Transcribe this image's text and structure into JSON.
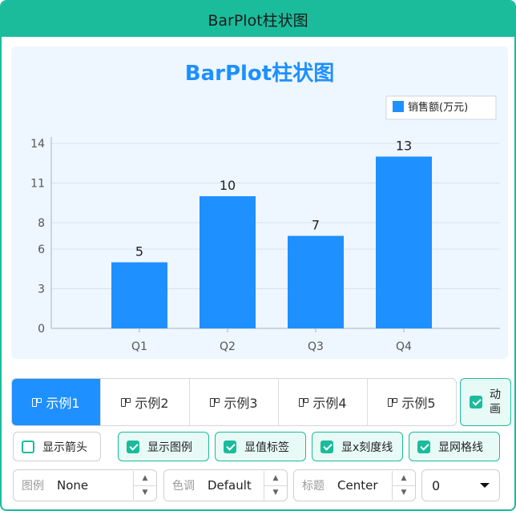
{
  "window": {
    "title": "BarPlot柱状图"
  },
  "chart_data": {
    "type": "bar",
    "title": "BarPlot柱状图",
    "categories": [
      "Q1",
      "Q2",
      "Q3",
      "Q4"
    ],
    "series": [
      {
        "name": "销售额(万元)",
        "values": [
          5,
          10,
          7,
          13
        ],
        "color": "#1e90ff"
      }
    ],
    "data_labels": [
      "5",
      "10",
      "7",
      "13"
    ],
    "ylim": [
      0,
      14
    ],
    "y_ticks": [
      0,
      3,
      6,
      8,
      11,
      14
    ],
    "grid": true,
    "legend_position": "top-right"
  },
  "colors": {
    "accent": "#1abc9c",
    "bar": "#1e90ff",
    "chart_bg": "#eef6ff",
    "title": "#1e90ff"
  },
  "tabs": [
    {
      "label": "示例1",
      "active": true
    },
    {
      "label": "示例2",
      "active": false
    },
    {
      "label": "示例3",
      "active": false
    },
    {
      "label": "示例4",
      "active": false
    },
    {
      "label": "示例5",
      "active": false
    }
  ],
  "animation": {
    "label": "动画",
    "checked": true
  },
  "options": [
    {
      "label": "显示箭头",
      "checked": false
    },
    {
      "label": "显示图例",
      "checked": true
    },
    {
      "label": "显值标签",
      "checked": true
    },
    {
      "label": "显x刻度线",
      "checked": true
    },
    {
      "label": "显网格线",
      "checked": true
    }
  ],
  "spinners": [
    {
      "label": "图例",
      "value": "None"
    },
    {
      "label": "色调",
      "value": "Default"
    },
    {
      "label": "标题",
      "value": "Center"
    }
  ],
  "combo": {
    "value": "0"
  },
  "icons": {
    "tab": "grid-icon",
    "spin_up": "caret-up-icon",
    "spin_down": "caret-down-icon",
    "combo": "caret-down-icon"
  }
}
